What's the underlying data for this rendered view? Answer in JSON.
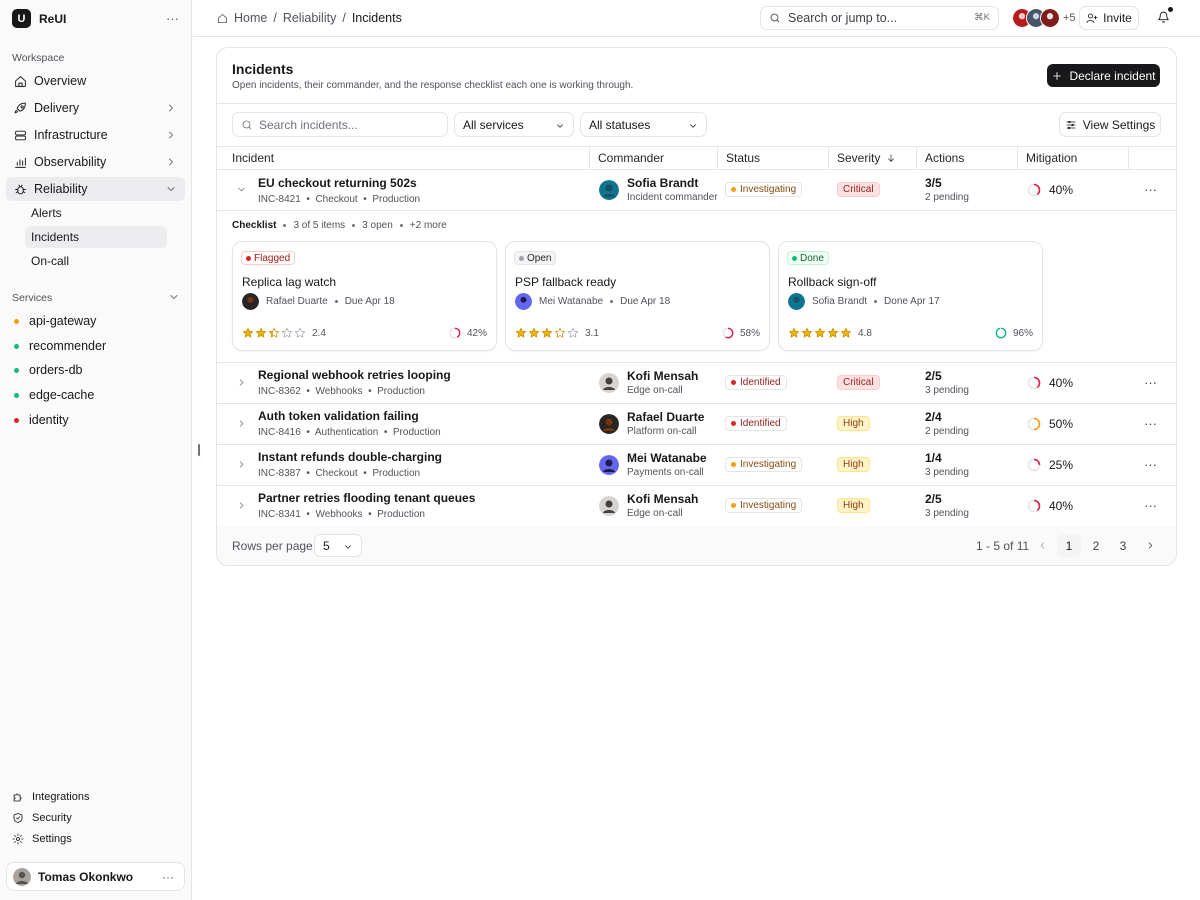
{
  "app": {
    "name": "ReUI"
  },
  "sidebar": {
    "workspace_label": "Workspace",
    "nav": [
      {
        "label": "Overview",
        "icon": "home-icon"
      },
      {
        "label": "Delivery",
        "icon": "rocket-icon"
      },
      {
        "label": "Infrastructure",
        "icon": "server-icon"
      },
      {
        "label": "Observability",
        "icon": "bar-chart-icon"
      },
      {
        "label": "Reliability",
        "icon": "bug-icon"
      }
    ],
    "reliability_children": [
      "Alerts",
      "Incidents",
      "On-call"
    ],
    "services_label": "Services",
    "services": [
      {
        "name": "api-gateway",
        "color": "#f59e0b"
      },
      {
        "name": "recommender",
        "color": "#10b981"
      },
      {
        "name": "orders-db",
        "color": "#10b981"
      },
      {
        "name": "edge-cache",
        "color": "#10b981"
      },
      {
        "name": "identity",
        "color": "#dc2626"
      }
    ],
    "footer": [
      {
        "label": "Integrations",
        "icon": "puzzle-icon"
      },
      {
        "label": "Security",
        "icon": "shield-icon"
      },
      {
        "label": "Settings",
        "icon": "gear-icon"
      }
    ],
    "user": {
      "name": "Tomas Okonkwo"
    }
  },
  "topbar": {
    "breadcrumb": [
      "Home",
      "Reliability",
      "Incidents"
    ],
    "search_placeholder": "Search or jump to...",
    "shortcut": "⌘K",
    "avatar_more": "+5",
    "invite": "Invite"
  },
  "page": {
    "title": "Incidents",
    "subtitle": "Open incidents, their commander, and the response checklist each one is working through.",
    "declare_button": "Declare incident",
    "search_placeholder": "Search incidents...",
    "filter_services": "All services",
    "filter_statuses": "All statuses",
    "view_settings": "View Settings"
  },
  "table": {
    "columns": [
      "Incident",
      "Commander",
      "Status",
      "Severity",
      "Actions",
      "Mitigation"
    ],
    "rows": [
      {
        "title": "EU checkout returning 502s",
        "id": "INC-8421",
        "service": "Checkout",
        "env": "Production",
        "commander": "Sofia Brandt",
        "role": "Incident commander",
        "status": "Investigating",
        "severity": "Critical",
        "actions": "3/5",
        "pending": "2 pending",
        "mitigation": "40%",
        "mitigation_value": 0.4,
        "expanded": true
      },
      {
        "title": "Regional webhook retries looping",
        "id": "INC-8362",
        "service": "Webhooks",
        "env": "Production",
        "commander": "Kofi Mensah",
        "role": "Edge on-call",
        "status": "Identified",
        "severity": "Critical",
        "actions": "2/5",
        "pending": "3 pending",
        "mitigation": "40%",
        "mitigation_value": 0.4
      },
      {
        "title": "Auth token validation failing",
        "id": "INC-8416",
        "service": "Authentication",
        "env": "Production",
        "commander": "Rafael Duarte",
        "role": "Platform on-call",
        "status": "Identified",
        "severity": "High",
        "actions": "2/4",
        "pending": "2 pending",
        "mitigation": "50%",
        "mitigation_value": 0.5
      },
      {
        "title": "Instant refunds double-charging",
        "id": "INC-8387",
        "service": "Checkout",
        "env": "Production",
        "commander": "Mei Watanabe",
        "role": "Payments on-call",
        "status": "Investigating",
        "severity": "High",
        "actions": "1/4",
        "pending": "3 pending",
        "mitigation": "25%",
        "mitigation_value": 0.25
      },
      {
        "title": "Partner retries flooding tenant queues",
        "id": "INC-8341",
        "service": "Webhooks",
        "env": "Production",
        "commander": "Kofi Mensah",
        "role": "Edge on-call",
        "status": "Investigating",
        "severity": "High",
        "actions": "2/5",
        "pending": "3 pending",
        "mitigation": "40%",
        "mitigation_value": 0.4
      }
    ]
  },
  "checklist": {
    "label": "Checklist",
    "summary": [
      "3 of 5 items",
      "3 open",
      "+2 more"
    ],
    "cards": [
      {
        "badge": "Flagged",
        "title": "Replica lag watch",
        "owner": "Rafael Duarte",
        "due": "Due Apr 18",
        "rating": 2.4,
        "rating_label": "2.4",
        "progress": "42%",
        "progress_value": 0.42
      },
      {
        "badge": "Open",
        "title": "PSP fallback ready",
        "owner": "Mei Watanabe",
        "due": "Due Apr 18",
        "rating": 3.1,
        "rating_label": "3.1",
        "progress": "58%",
        "progress_value": 0.58
      },
      {
        "badge": "Done",
        "title": "Rollback sign-off",
        "owner": "Sofia Brandt",
        "due": "Done Apr 17",
        "rating": 4.8,
        "rating_label": "4.8",
        "progress": "96%",
        "progress_value": 0.96
      }
    ]
  },
  "pagination": {
    "rows_label": "Rows per page",
    "rows_value": "5",
    "range": "1 - 5 of 11",
    "pages": [
      "1",
      "2",
      "3"
    ]
  }
}
